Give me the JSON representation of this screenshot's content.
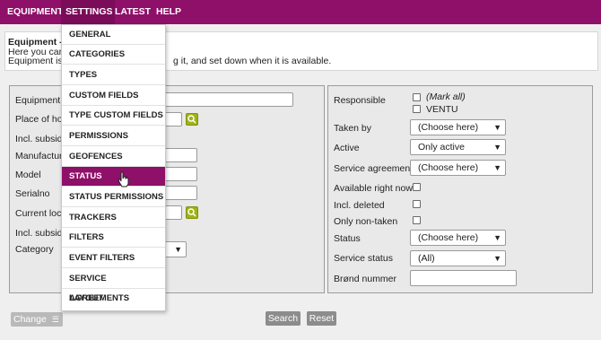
{
  "nav": {
    "items": [
      "EQUIPMENT",
      "SETTINGS",
      "LATEST",
      "HELP"
    ]
  },
  "info": {
    "title": "Equipment - s",
    "line1": "Here you can s",
    "line2_prefix": "Equipment is",
    "line2_suffix": "g it, and set down when it is available."
  },
  "left_form": {
    "equipment_label": "Equipment",
    "place_label": "Place of hom",
    "incl_subsid_1": "Incl. subsidi",
    "manufacturer_label": "Manufacture",
    "model_label": "Model",
    "serialno_label": "Serialno",
    "current_location_label": "Current locat",
    "incl_subsid_2": "Incl. subsidia",
    "category_label": "Category"
  },
  "right_form": {
    "responsible_label": "Responsible",
    "mark_all": "(Mark all)",
    "ventu": "VENTU",
    "taken_by_label": "Taken by",
    "taken_by_value": "(Choose here)",
    "active_label": "Active",
    "active_value": "Only active",
    "service_agreement_label": "Service agreement",
    "service_agreement_value": "(Choose here)",
    "available_label": "Available right now",
    "incl_deleted_label": "Incl. deleted",
    "only_non_taken_label": "Only non-taken",
    "status_label": "Status",
    "status_value": "(Choose here)",
    "service_status_label": "Service status",
    "service_status_value": "(All)",
    "brond_label": "Brønd nummer"
  },
  "buttons": {
    "change": "Change",
    "search": "Search",
    "reset": "Reset"
  },
  "menu": {
    "items": [
      "GENERAL",
      "CATEGORIES",
      "TYPES",
      "CUSTOM FIELDS",
      "TYPE CUSTOM FIELDS",
      "PERMISSIONS",
      "GEOFENCES",
      "STATUS",
      "STATUS PERMISSIONS",
      "TRACKERS",
      "FILTERS",
      "EVENT FILTERS",
      "SERVICE AGREEMENTS",
      "LAYOUT"
    ],
    "selected": "STATUS"
  },
  "colors": {
    "brand": "#8e1069",
    "search_button_green": "#9fb313"
  }
}
